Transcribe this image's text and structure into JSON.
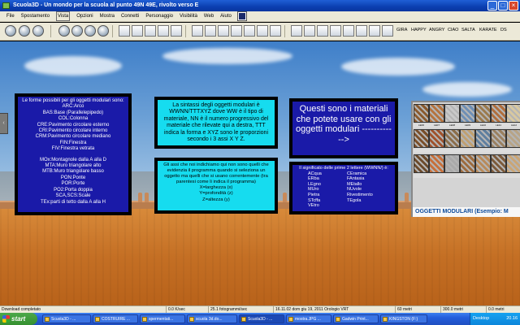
{
  "window": {
    "title": "Scuola3D - Un mondo per la scuola al punto 49N 49E, rivolto verso E"
  },
  "menu": {
    "items": [
      "File",
      "Spostamento",
      "Vista",
      "Opzioni",
      "Mostra",
      "Connetti",
      "Personaggio",
      "Visibilità",
      "Web",
      "Aiuto"
    ],
    "active": "Vista"
  },
  "toolbar": {
    "animations": [
      "GIRA",
      "HAPPY",
      "ANGRY",
      "CIAO",
      "SALTA",
      "KARATE",
      "DS"
    ]
  },
  "panel1": {
    "intro": "Le forme possibili per gli oggetti modulari sono:",
    "shapes_a": [
      "ARC:Arco",
      "BAS:Base (Parallelepipedo)",
      "COL:Colonna",
      "CRE:Pavimento circolare esterno",
      "CRI:Pavimento circolare interno",
      "CRM:Pavimento circolare mediano",
      "FIN:Finestra",
      "FIV:Finestra vetrata"
    ],
    "shapes_b": [
      "MOx:Montagnole dalla A alla D",
      "MTA:Muro triangolare alto",
      "MTB:Muro triangolare basso",
      "PON:Ponte",
      "POR:Porte",
      "PO2:Porta doppia",
      "SCA,SCS:Scale",
      "TEx:parti di tetto dalla A alla H"
    ]
  },
  "panel2": {
    "top": "La sintassi degli oggetti modulari è WWNN/TTTXYZ dove WW è il tipo di materiale, NN è il numero progressivo del materiale che rilevate qui a destra, TTT indica la forma e XYZ sono le proporzioni secondo i 3 assi X Y Z.",
    "bottom": "Gli assi che noi indichiamo qui non sono quelli che evidenzia il programma quando si seleziona un oggetto ma quelli che si usano correntemente (tra parentesi come li indica il programma)",
    "axes": [
      "X=larghezza   (x)",
      "Y=profondità  (z)",
      "Z=altezza      (y)"
    ]
  },
  "panel3": {
    "top": "Questi sono i materiali che potete usare con gli oggetti modulari ------------>",
    "bottom_head": "Il significato delle prime 2 lettere (WWNN/) è:",
    "codes_left": [
      "ACqua",
      "ERba",
      "LEgno",
      "MUro",
      "Pietra",
      "STcffa"
    ],
    "codes_right": [
      "CEramica",
      "FAntasia",
      "MEtallo",
      "NUvole",
      "Rivestimento",
      "TEgola"
    ],
    "codes_last": "VEtro"
  },
  "materials": {
    "label": "OGGETTI MODULARI (Esempio: M",
    "swatch_codes": [
      "LE06",
      "LE07",
      "LE08",
      "LE09",
      "LE10",
      "LE11",
      "LE12"
    ]
  },
  "statusbar": {
    "cells": [
      "Download completato",
      "0.0 K/sec",
      "25.1 fotogrammi/sec",
      "16.11.02 dom giu 19, 2011 Orologio VRT",
      "60 metri",
      "300.0 metri",
      "0.0 metri"
    ]
  },
  "taskbar": {
    "start": "start",
    "tasks": [
      "Scuola3D - ...",
      "COSTRUIRE ...",
      "spermentati...",
      "scuola 3d.do...",
      "Scuola3D - ...",
      "mostra.JPG ...",
      "Gadwin Print...",
      "KINGSTON (F:)"
    ],
    "active_index": 4,
    "tray_label": "Desktop",
    "clock": "20.16"
  },
  "colors": {
    "panel_blue": "#1a1aa8",
    "panel_cyan": "#16dcef",
    "floor": "#c46f24"
  }
}
